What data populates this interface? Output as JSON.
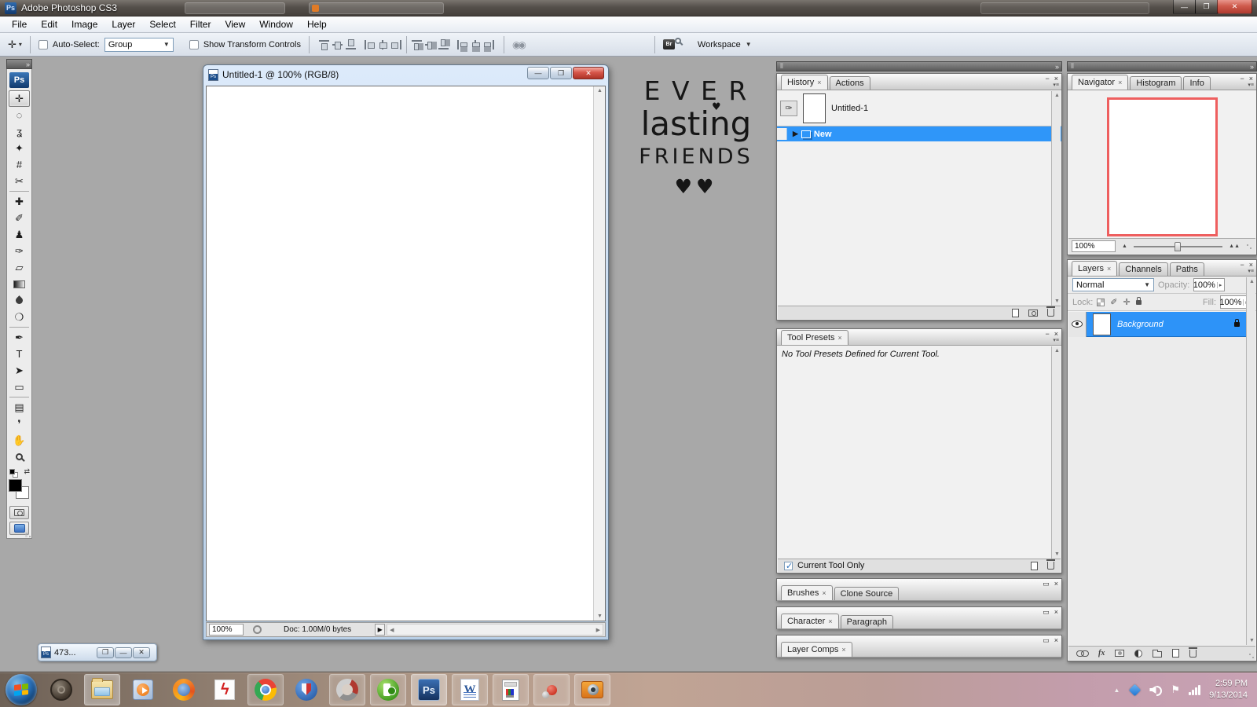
{
  "titlebar": {
    "title": "Adobe Photoshop CS3",
    "app_badge": "Ps"
  },
  "window_controls": {
    "minimize": "—",
    "maximize": "❐",
    "close": "✕"
  },
  "menus": [
    "File",
    "Edit",
    "Image",
    "Layer",
    "Select",
    "Filter",
    "View",
    "Window",
    "Help"
  ],
  "options": {
    "tool_glyph": "✛",
    "auto_select": {
      "label": "Auto-Select:",
      "checked": false,
      "value": "Group"
    },
    "show_transform": {
      "label": "Show Transform Controls",
      "checked": false
    },
    "align_icons": [
      "align-top-edges",
      "align-vertical-centers",
      "align-bottom-edges",
      "align-left-edges",
      "align-horizontal-centers",
      "align-right-edges",
      "distribute-top-edges",
      "distribute-vertical-centers",
      "distribute-bottom-edges",
      "distribute-left-edges",
      "distribute-horizontal-centers",
      "distribute-right-edges"
    ],
    "auto_align_glyph": "◉◉",
    "bridge_label": "Br",
    "workspace_label": "Workspace"
  },
  "wallpaper": {
    "line1": "E V E R",
    "line2": "lasting",
    "line3": "FRIENDS",
    "hearts": "♥♥",
    "heart_dot": "♥"
  },
  "toolbox": {
    "logo": "Ps",
    "tools": [
      {
        "name": "move-tool",
        "glyph": "✛",
        "selected": true
      },
      {
        "name": "elliptical-marquee-tool",
        "glyph": "◌"
      },
      {
        "name": "lasso-tool",
        "glyph": "ʓ"
      },
      {
        "name": "quick-selection-tool",
        "glyph": "✦"
      },
      {
        "name": "crop-tool",
        "glyph": "#"
      },
      {
        "name": "slice-tool",
        "glyph": "✂"
      },
      {
        "name": "healing-brush-tool",
        "glyph": "✚"
      },
      {
        "name": "brush-tool",
        "glyph": "✐"
      },
      {
        "name": "clone-stamp-tool",
        "glyph": "♟"
      },
      {
        "name": "history-brush-tool",
        "glyph": "✑"
      },
      {
        "name": "eraser-tool",
        "glyph": "▱"
      },
      {
        "name": "gradient-tool",
        "glyph": ""
      },
      {
        "name": "blur-tool",
        "glyph": ""
      },
      {
        "name": "dodge-tool",
        "glyph": "❍"
      },
      {
        "name": "pen-tool",
        "glyph": "✒"
      },
      {
        "name": "type-tool",
        "glyph": "T"
      },
      {
        "name": "path-selection-tool",
        "glyph": "➤"
      },
      {
        "name": "shape-tool",
        "glyph": "▭"
      },
      {
        "name": "notes-tool",
        "glyph": "▤"
      },
      {
        "name": "eyedropper-tool",
        "glyph": "❜"
      },
      {
        "name": "hand-tool",
        "glyph": "✋"
      },
      {
        "name": "zoom-tool",
        "glyph": ""
      }
    ],
    "foreground_color": "#000000",
    "background_color": "#ffffff"
  },
  "document": {
    "icon_badge": "Ps",
    "title": "Untitled-1 @ 100% (RGB/8)",
    "zoom": "100%",
    "info": "Doc: 1.00M/0 bytes"
  },
  "panels": {
    "history": {
      "tabs": [
        "History",
        "Actions"
      ],
      "snapshot": "Untitled-1",
      "state": "New"
    },
    "tool_presets": {
      "tab": "Tool Presets",
      "message": "No Tool Presets Defined for Current Tool.",
      "footer_label": "Current Tool Only",
      "footer_checked": true
    },
    "brushes": {
      "tabs": [
        "Brushes",
        "Clone Source"
      ]
    },
    "character": {
      "tabs": [
        "Character",
        "Paragraph"
      ]
    },
    "layer_comps": {
      "tabs": [
        "Layer Comps"
      ]
    },
    "navigator": {
      "tabs": [
        "Navigator",
        "Histogram",
        "Info"
      ],
      "zoom": "100%",
      "proxy_border_color": "#ee5f5f"
    },
    "layers": {
      "tabs": [
        "Layers",
        "Channels",
        "Paths"
      ],
      "blend_mode": "Normal",
      "opacity_label": "Opacity:",
      "opacity": "100%",
      "lock_label": "Lock:",
      "fill_label": "Fill:",
      "fill": "100%",
      "layer_name": "Background"
    }
  },
  "minimized_window": {
    "title": "473..."
  },
  "taskbar": {
    "apps": [
      {
        "name": "dark-circle-app",
        "running": false
      },
      {
        "name": "explorer",
        "running": true,
        "active": true
      },
      {
        "name": "media-player",
        "running": false
      },
      {
        "name": "firefox",
        "running": false
      },
      {
        "name": "lightning-app",
        "running": false
      },
      {
        "name": "chrome",
        "running": true
      },
      {
        "name": "shield-app",
        "running": false
      },
      {
        "name": "swirl-app",
        "running": true
      },
      {
        "name": "green-app",
        "running": true
      },
      {
        "name": "photoshop",
        "running": true,
        "active": true,
        "label": "Ps"
      },
      {
        "name": "word",
        "running": true,
        "label": "W"
      },
      {
        "name": "html-document",
        "running": true
      },
      {
        "name": "molecule-app",
        "running": true
      },
      {
        "name": "camera-app",
        "running": true
      }
    ],
    "tray": {
      "time": "2:59 PM",
      "date": "9/13/2014"
    }
  },
  "colors": {
    "selection_blue": "#2f96f9",
    "desktop_gray": "#a8a8a8",
    "taskbar_tint": "#b29a89"
  }
}
